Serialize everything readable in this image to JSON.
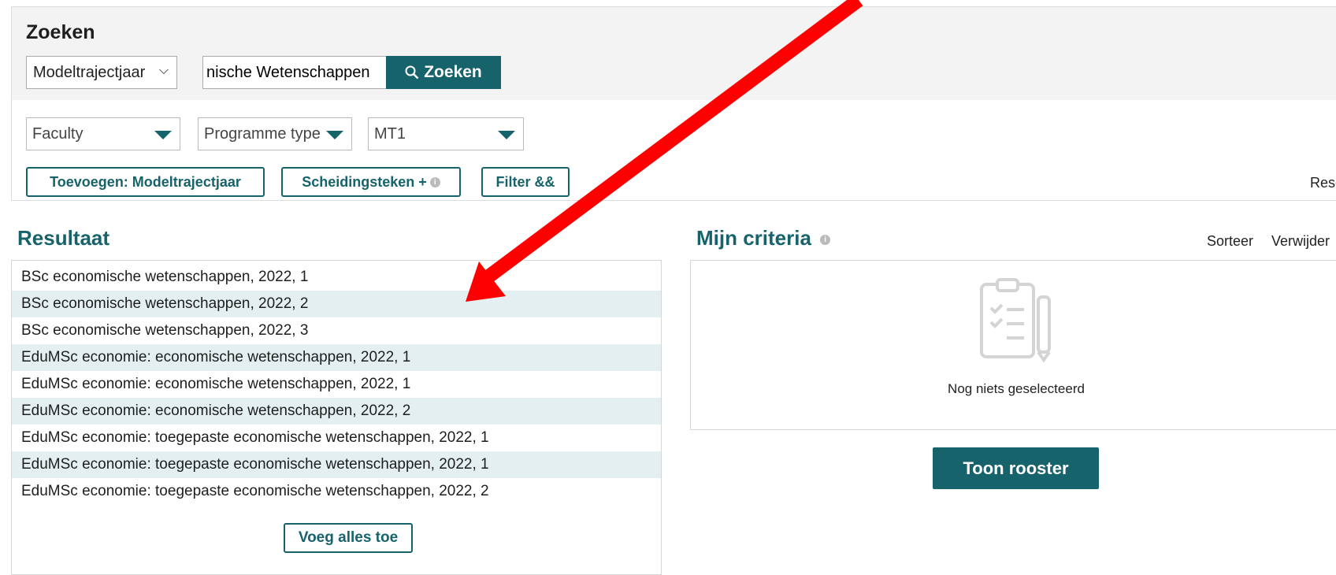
{
  "search": {
    "title": "Zoeken",
    "mode_selected": "Modeltrajectjaar",
    "query_value": "nische Wetenschappen",
    "search_button": "Zoeken"
  },
  "filters": {
    "faculty": "Faculty",
    "programme_type": "Programme type",
    "year_filter": "MT1"
  },
  "actions": {
    "add_label": "Toevoegen: Modeltrajectjaar",
    "separator_label": "Scheidingsteken +",
    "filter_label": "Filter &&",
    "reset_label": "Reset"
  },
  "results": {
    "title": "Resultaat",
    "items": [
      "BSc economische wetenschappen, 2022, 1",
      "BSc economische wetenschappen, 2022, 2",
      "BSc economische wetenschappen, 2022, 3",
      "EduMSc economie: economische wetenschappen, 2022, 1",
      "EduMSc economie: economische wetenschappen, 2022, 1",
      "EduMSc economie: economische wetenschappen, 2022, 2",
      "EduMSc economie: toegepaste economische wetenschappen, 2022, 1",
      "EduMSc economie: toegepaste economische wetenschappen, 2022, 1",
      "EduMSc economie: toegepaste economische wetenschappen, 2022, 2"
    ],
    "add_all_label": "Voeg alles toe"
  },
  "criteria": {
    "title": "Mijn criteria",
    "sort_label": "Sorteer",
    "remove_label": "Verwijder",
    "empty_text": "Nog niets geselecteerd",
    "show_button": "Toon rooster"
  },
  "colors": {
    "accent": "#17636b",
    "row_alt": "#e4eff1",
    "annotation": "#ff0000"
  },
  "icons": [
    "search-icon",
    "chevron-down-icon",
    "info-icon",
    "clipboard-icon",
    "annotation-arrow"
  ]
}
